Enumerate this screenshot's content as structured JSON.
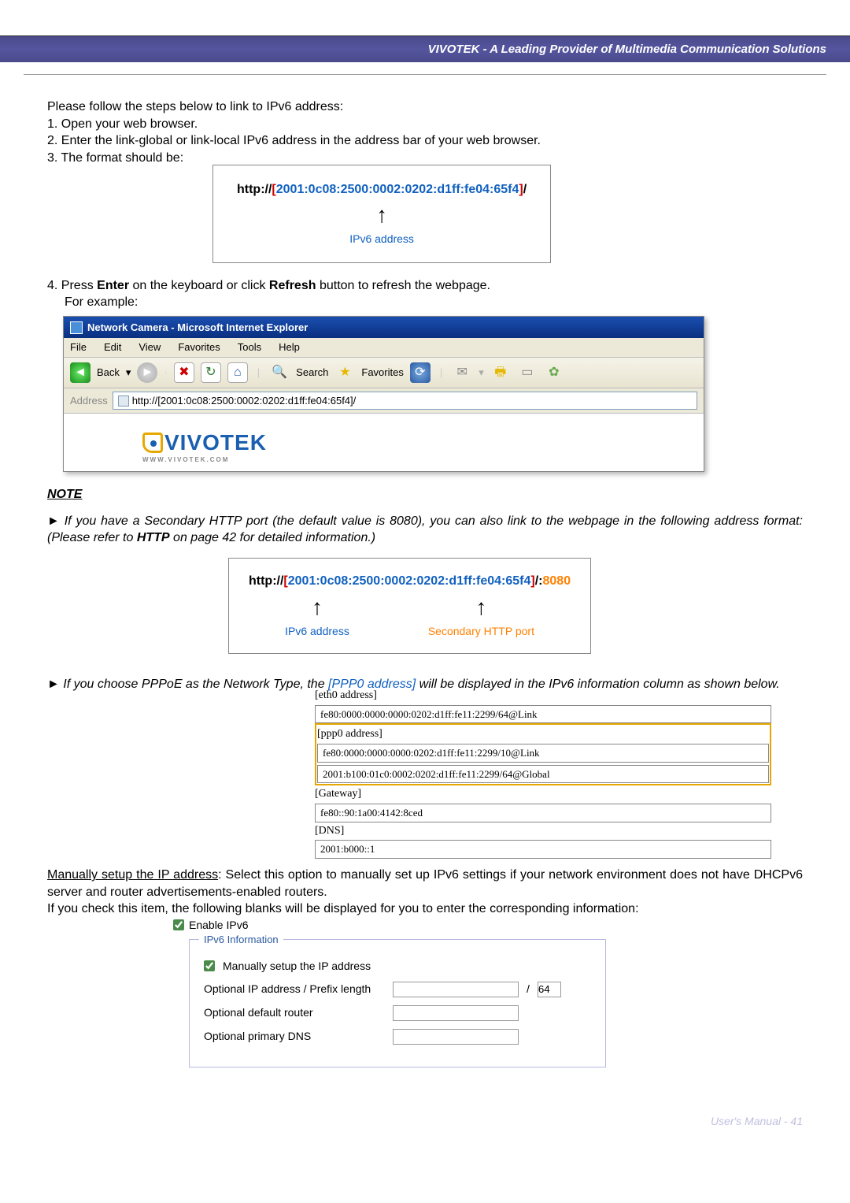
{
  "header": {
    "banner": "VIVOTEK - A Leading Provider of Multimedia Communication Solutions"
  },
  "intro": {
    "lead": "Please follow the steps below to link to IPv6 address:",
    "step1": "1. Open your web browser.",
    "step2": "2. Enter the link-global or link-local IPv6 address in the address bar of your web browser.",
    "step3": "3. The format should be:"
  },
  "urlbox1": {
    "prefix": "http://",
    "open": "[",
    "addr": "2001:0c08:2500:0002:0202:d1ff:fe04:65f4",
    "close": "]",
    "suffix": "/",
    "label": "IPv6 address"
  },
  "step4": {
    "line1_a": "4. Press ",
    "line1_b": "Enter",
    "line1_c": " on the keyboard or click ",
    "line1_d": "Refresh",
    "line1_e": " button to refresh the webpage.",
    "line2": "For example:"
  },
  "ie": {
    "title": "Network Camera - Microsoft Internet Explorer",
    "menu": {
      "file": "File",
      "edit": "Edit",
      "view": "View",
      "favorites": "Favorites",
      "tools": "Tools",
      "help": "Help"
    },
    "toolbar": {
      "back": "Back",
      "search": "Search",
      "favorites": "Favorites"
    },
    "addr_label": "Address",
    "addr_value": "http://[2001:0c08:2500:0002:0202:d1ff:fe04:65f4]/",
    "logo": "VIVOTEK",
    "logo_sub": "WWW.VIVOTEK.COM"
  },
  "note": {
    "heading": "NOTE",
    "p1_a": "► If you have a Secondary HTTP port (the default value is 8080), you can also link to the webpage in the following address format: (Please refer to ",
    "p1_b": "HTTP",
    "p1_c": " on page 42 for detailed information.)"
  },
  "urlbox2": {
    "prefix": "http://",
    "open": "[",
    "addr": "2001:0c08:2500:0002:0202:d1ff:fe04:65f4",
    "close": "]",
    "suffix": "/:",
    "port": "8080",
    "label_addr": "IPv6 address",
    "label_port": "Secondary HTTP port"
  },
  "pppoe": {
    "p_a": "► If you choose PPPoE as the Network Type, the ",
    "p_b": "[PPP0 address]",
    "p_c": " will be displayed in the IPv6 information column as shown below."
  },
  "ipv6info": {
    "eth0_label": "[eth0 address]",
    "eth0_val": "fe80:0000:0000:0000:0202:d1ff:fe11:2299/64@Link",
    "ppp0_label": "[ppp0 address]",
    "ppp0_val1": "fe80:0000:0000:0000:0202:d1ff:fe11:2299/10@Link",
    "ppp0_val2": "2001:b100:01c0:0002:0202:d1ff:fe11:2299/64@Global",
    "gw_label": "[Gateway]",
    "gw_val": "fe80::90:1a00:4142:8ced",
    "dns_label": "[DNS]",
    "dns_val": "2001:b000::1"
  },
  "manual": {
    "heading": "Manually setup the IP address",
    "p1": ": Select this option to manually set up IPv6 settings if your network environment does not have DHCPv6 server and router advertisements-enabled routers.",
    "p2": "If you check this item, the following blanks will be displayed for you to enter the corresponding information:",
    "enable_label": "Enable IPv6"
  },
  "form": {
    "legend": "IPv6 Information",
    "chk_label": "Manually setup the IP address",
    "row1": "Optional IP address / Prefix length",
    "row1_prefix": "64",
    "row2": "Optional default router",
    "row3": "Optional primary DNS"
  },
  "footer": {
    "text": "User's Manual - 41"
  }
}
